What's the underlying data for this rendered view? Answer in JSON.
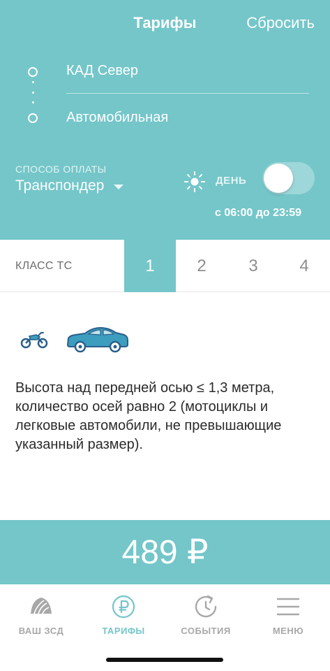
{
  "nav": {
    "title": "Тарифы",
    "reset_label": "Сбросить"
  },
  "route": {
    "from": "КАД Север",
    "to": "Автомобильная"
  },
  "payment": {
    "label": "СПОСОБ ОПЛАТЫ",
    "value": "Транспондер"
  },
  "day_mode": {
    "label": "ДЕНЬ",
    "enabled": false,
    "time_range": "с 06:00 до 23:59"
  },
  "vehicle_class": {
    "label": "КЛАСС ТС",
    "tabs": [
      "1",
      "2",
      "3",
      "4"
    ],
    "selected": "1"
  },
  "vehicles": {
    "icons": [
      "motorcycle-icon",
      "car-icon"
    ]
  },
  "description": "Высота над передней осью ≤ 1,3 метра, количество осей равно 2 (мотоциклы и легковые автомобили, не превышающие указанный размер).",
  "price": "489 ₽",
  "colors": {
    "accent": "#74c6c9",
    "vehicle_fill": "#3d9dbf",
    "vehicle_stroke": "#2a5f8a"
  },
  "tabbar": {
    "items": [
      {
        "label": "ВАШ ЗСД",
        "icon": "logo-icon",
        "active": false
      },
      {
        "label": "ТАРИФЫ",
        "icon": "ruble-icon",
        "active": true
      },
      {
        "label": "СОБЫТИЯ",
        "icon": "history-icon",
        "active": false
      },
      {
        "label": "МЕНЮ",
        "icon": "menu-icon",
        "active": false
      }
    ]
  }
}
